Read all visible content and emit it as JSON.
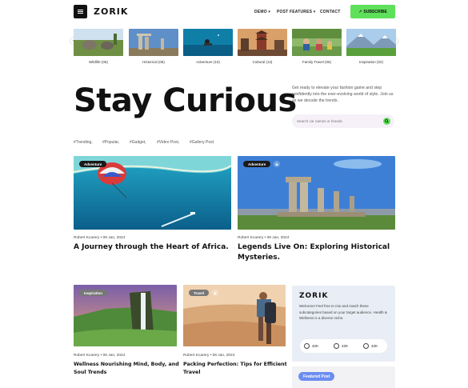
{
  "header": {
    "logo": "ZORIK",
    "nav": [
      {
        "label": "DEMO",
        "dropdown": true
      },
      {
        "label": "POST FEATURES",
        "dropdown": true
      },
      {
        "label": "CONTACT",
        "dropdown": false
      }
    ],
    "subscribe_label": "SUBSCRIBE",
    "accent_color": "#5fe05a"
  },
  "categories": [
    {
      "label": "Wildlife (06)"
    },
    {
      "label": "Historical (06)"
    },
    {
      "label": "Adventure (10)"
    },
    {
      "label": "Cultural (13)"
    },
    {
      "label": "Family Travel (06)"
    },
    {
      "label": "Inspiration (02)"
    }
  ],
  "hero": {
    "title": "Stay Curious",
    "description": "Get ready to elevate your fashion game and step confidently into the ever-evolving world of style. Join us as we decode the trends.",
    "search_placeholder": "Search car names or brands"
  },
  "tags": [
    "#Trending,",
    "#Popular,",
    "#Gadget,",
    "#Video Post,",
    "#Gallery Post"
  ],
  "featured_posts": [
    {
      "category": "Adventure",
      "author": "Robert Kcarery",
      "date": "08 Jan, 2024",
      "title": "A Journey through the Heart of Africa."
    },
    {
      "category": "Adventure",
      "author": "Robert Kcarery",
      "date": "08 Jan, 2024",
      "title": "Legends Live On: Exploring Historical Mysteries."
    }
  ],
  "posts": [
    {
      "category": "Inspiration",
      "author": "Robert Kcarery",
      "date": "06 Jan, 2024",
      "title": "Wellness Nourishing Mind, Body, and Soul Trends"
    },
    {
      "category": "Travel",
      "author": "Robert Kcarery",
      "date": "08 Jan, 2024",
      "title": "Packing Perfection: Tips for Efficient Travel"
    }
  ],
  "sidebar": {
    "logo": "ZORIK",
    "text": "Welcome! Feel free to mix and match these subcategories based on your target audience. Health & Wellness is a diverse niche.",
    "social": [
      {
        "icon": "facebook-icon",
        "count": "42K"
      },
      {
        "icon": "youtube-icon",
        "count": "42K"
      },
      {
        "icon": "instagram-icon",
        "count": "42K"
      }
    ],
    "featured_label": "Featured Post"
  }
}
